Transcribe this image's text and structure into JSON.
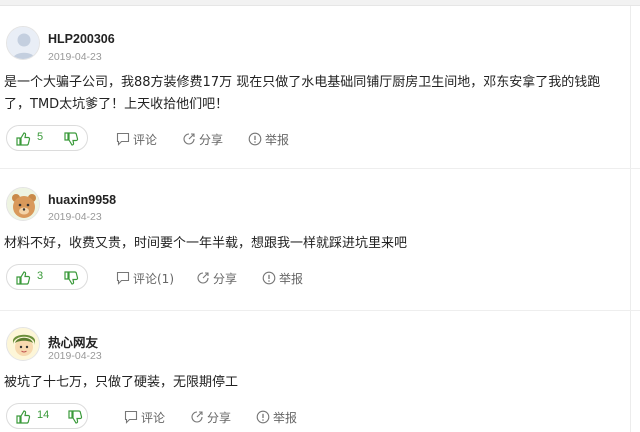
{
  "comments": [
    {
      "username": "HLP200306",
      "date": "2019-04-23",
      "text": "是一个大骗子公司，我88方装修费17万 现在只做了水电基础同铺厅厨房卫生间地，邓东安拿了我的钱跑了，TMD太坑爹了！上天收拾他们吧！",
      "likes": "5",
      "comment_label": "评论",
      "share_label": "分享",
      "report_label": "举报",
      "avatar": "default-user-avatar"
    },
    {
      "username": "huaxin9958",
      "date": "2019-04-23",
      "text": "材料不好，收费又贵，时间要个一年半载，想跟我一样就踩进坑里来吧",
      "likes": "3",
      "comment_label": "评论(1)",
      "share_label": "分享",
      "report_label": "举报",
      "avatar": "bear-avatar"
    },
    {
      "username": "热心网友",
      "date": "2019-04-23",
      "text": "被坑了十七万，只做了硬装，无限期停工",
      "likes": "14",
      "comment_label": "评论",
      "share_label": "分享",
      "report_label": "举报",
      "avatar": "cartoon-person-avatar"
    }
  ],
  "colors": {
    "like_green": "#3a9a3a",
    "dislike_green": "#3a9a3a",
    "text_gray": "#666666"
  },
  "icons": {
    "like": "thumbs-up-icon",
    "dislike": "thumbs-down-icon",
    "comment": "comment-icon",
    "share": "share-icon",
    "report": "report-icon"
  }
}
